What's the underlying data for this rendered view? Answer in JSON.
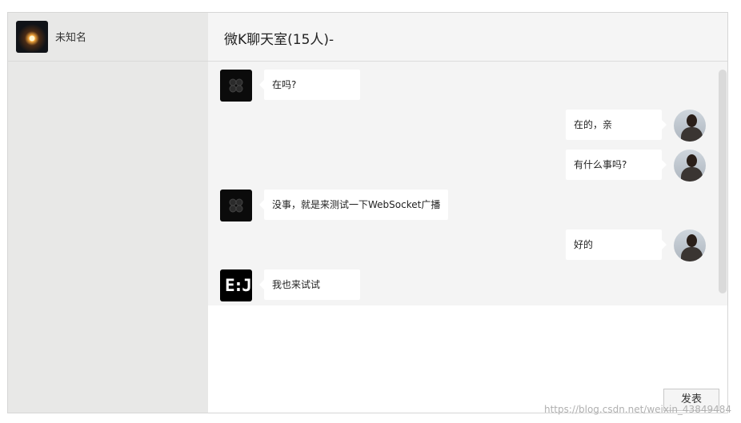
{
  "user": {
    "name": "未知名",
    "avatar_icon": "sunset-avatar-icon"
  },
  "chat": {
    "title": "微K聊天室(15人)-"
  },
  "messages": [
    {
      "side": "left",
      "avatar": "clover-avatar-icon",
      "text": "在吗?"
    },
    {
      "side": "right",
      "avatar": "person-avatar-icon",
      "text": "在的，亲"
    },
    {
      "side": "right",
      "avatar": "person-avatar-icon",
      "text": "有什么事吗?"
    },
    {
      "side": "left",
      "avatar": "clover-avatar-icon",
      "text": "没事，就是来测试一下WebSocket广播"
    },
    {
      "side": "right",
      "avatar": "person-avatar-icon",
      "text": "好的"
    },
    {
      "side": "left",
      "avatar": "ej-avatar-icon",
      "text": "我也来试试"
    }
  ],
  "composer": {
    "send_label": "发表"
  },
  "watermark": "https://blog.csdn.net/weixin_43849484",
  "colors": {
    "sidebar_bg": "#e8e8e7",
    "messages_bg": "#f4f4f4",
    "bubble_bg": "#ffffff"
  }
}
